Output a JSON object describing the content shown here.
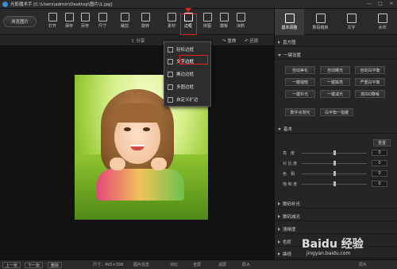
{
  "window": {
    "title": "光影魔术手 [C:\\Users\\admin\\Desktop\\图片\\1.jpg]",
    "controls": [
      "—",
      "□",
      "✕"
    ]
  },
  "toolbar": {
    "browse_label": "浏览图片",
    "tools": [
      {
        "label": "打开",
        "icon": "folder-icon"
      },
      {
        "label": "保存",
        "icon": "save-icon"
      },
      {
        "label": "另存",
        "icon": "save-as-icon"
      },
      {
        "label": "尺寸",
        "icon": "resize-icon"
      },
      {
        "label": "裁剪",
        "icon": "crop-icon"
      },
      {
        "label": "旋转",
        "icon": "rotate-icon"
      },
      {
        "label": "素材",
        "icon": "material-icon"
      },
      {
        "label": "边框",
        "icon": "border-icon"
      },
      {
        "label": "拼图",
        "icon": "collage-icon"
      },
      {
        "label": "模板",
        "icon": "template-icon"
      },
      {
        "label": "涂鸦",
        "icon": "doodle-icon"
      }
    ]
  },
  "subbar": {
    "share": "分享",
    "redo": "重做",
    "undo": "还原"
  },
  "border_menu": {
    "items": [
      "轻松边框",
      "文字边框",
      "撕边边框",
      "多图边框",
      "自定义扩边"
    ],
    "selected_index": 1
  },
  "status": {
    "prev": "上一张",
    "next": "下一张",
    "delete": "删除",
    "size_text": "尺寸：495×398",
    "info": "图片信息",
    "compare": "对比",
    "fullscreen": "全屏",
    "fit": "适屏",
    "original": "原大",
    "other": "原片"
  },
  "right_panel": {
    "tabs": [
      {
        "label": "基本调整",
        "active": true
      },
      {
        "label": "数码暗房",
        "active": false
      },
      {
        "label": "文字",
        "active": false
      },
      {
        "label": "水印",
        "active": false
      }
    ],
    "sections": {
      "histogram": "直方图",
      "one_click": "一键设置",
      "basic": "基本",
      "fill_light": "数码补光",
      "reduce_light": "数码减光",
      "clarity": "清晰度",
      "levels": "色阶",
      "curves": "曲线"
    },
    "quick_buttons": [
      [
        "自动美化",
        "自动曝光",
        "自动白平衡"
      ],
      [
        "一键褪暗",
        "一键挑亮",
        "严重白平衡"
      ],
      [
        "一键补光",
        "一键减光",
        "高ISO降噪"
      ],
      [
        "数字点测光",
        "白平衡一指键"
      ]
    ],
    "reset_label": "重置",
    "sliders": [
      {
        "label": "亮　度",
        "value": "0",
        "level": 0.5
      },
      {
        "label": "对 比 度",
        "value": "0",
        "level": 0.5
      },
      {
        "label": "色　相",
        "value": "0",
        "level": 0.5
      },
      {
        "label": "饱 和 度",
        "value": "0",
        "level": 0.5
      }
    ]
  },
  "watermark": {
    "logo": "Baidu 经验",
    "url": "jingyan.baidu.com"
  },
  "colors": {
    "highlight": "#e02020",
    "background": "#1f1f1f",
    "panel": "#252525"
  }
}
